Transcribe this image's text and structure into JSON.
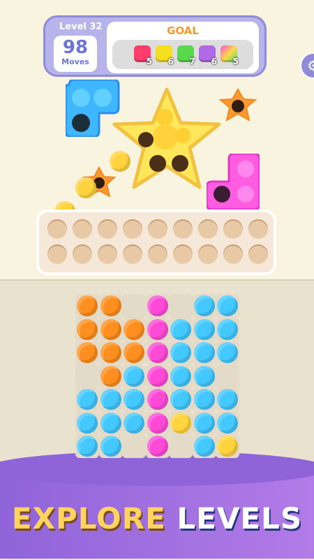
{
  "hud": {
    "level_label": "Level 32",
    "moves_value": "98",
    "moves_label": "Moves",
    "goal_title": "GOAL",
    "goals": [
      {
        "color": "#ff3c6b",
        "count": "5",
        "icon": "red-die-icon"
      },
      {
        "color": "#f4df1f",
        "count": "6",
        "icon": "yellow-die-icon"
      },
      {
        "color": "#58d84b",
        "count": "7",
        "icon": "green-die-icon"
      },
      {
        "color": "#b06ae7",
        "count": "6",
        "icon": "purple-die-icon"
      },
      {
        "color": "#ff8a2a",
        "count": "5",
        "icon": "rainbow-die-icon"
      }
    ]
  },
  "banner": {
    "word1": "EXPLORE",
    "word2": "LEVELS"
  },
  "colors": {
    "orange": "#ff8f1f",
    "blue": "#43c8ff",
    "pink": "#ff4ad8",
    "yellow": "#ffd33d"
  }
}
